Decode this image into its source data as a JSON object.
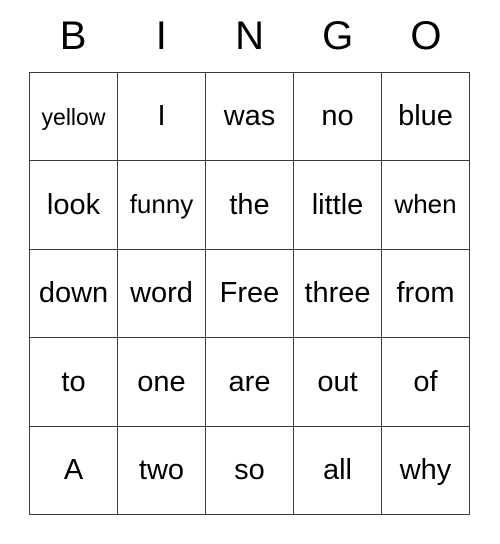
{
  "card": {
    "type": "bingo-card",
    "header": [
      "B",
      "I",
      "N",
      "G",
      "O"
    ],
    "colors": {
      "background": "#ffffff",
      "text": "#000000",
      "grid_line": "#3a3a3a"
    },
    "free_space": "Free",
    "rows": [
      [
        {
          "text": "yellow",
          "size": "sm"
        },
        {
          "text": "I",
          "size": "lg"
        },
        {
          "text": "was",
          "size": "lg"
        },
        {
          "text": "no",
          "size": "lg"
        },
        {
          "text": "blue",
          "size": "lg"
        }
      ],
      [
        {
          "text": "look",
          "size": "lg"
        },
        {
          "text": "funny",
          "size": "md"
        },
        {
          "text": "the",
          "size": "lg"
        },
        {
          "text": "little",
          "size": "lg"
        },
        {
          "text": "when",
          "size": "md"
        }
      ],
      [
        {
          "text": "down",
          "size": "lg"
        },
        {
          "text": "word",
          "size": "lg"
        },
        {
          "text": "Free",
          "size": "lg"
        },
        {
          "text": "three",
          "size": "lg"
        },
        {
          "text": "from",
          "size": "lg"
        }
      ],
      [
        {
          "text": "to",
          "size": "lg"
        },
        {
          "text": "one",
          "size": "lg"
        },
        {
          "text": "are",
          "size": "lg"
        },
        {
          "text": "out",
          "size": "lg"
        },
        {
          "text": "of",
          "size": "lg"
        }
      ],
      [
        {
          "text": "A",
          "size": "lg"
        },
        {
          "text": "two",
          "size": "lg"
        },
        {
          "text": "so",
          "size": "lg"
        },
        {
          "text": "all",
          "size": "lg"
        },
        {
          "text": "why",
          "size": "lg"
        }
      ]
    ]
  }
}
